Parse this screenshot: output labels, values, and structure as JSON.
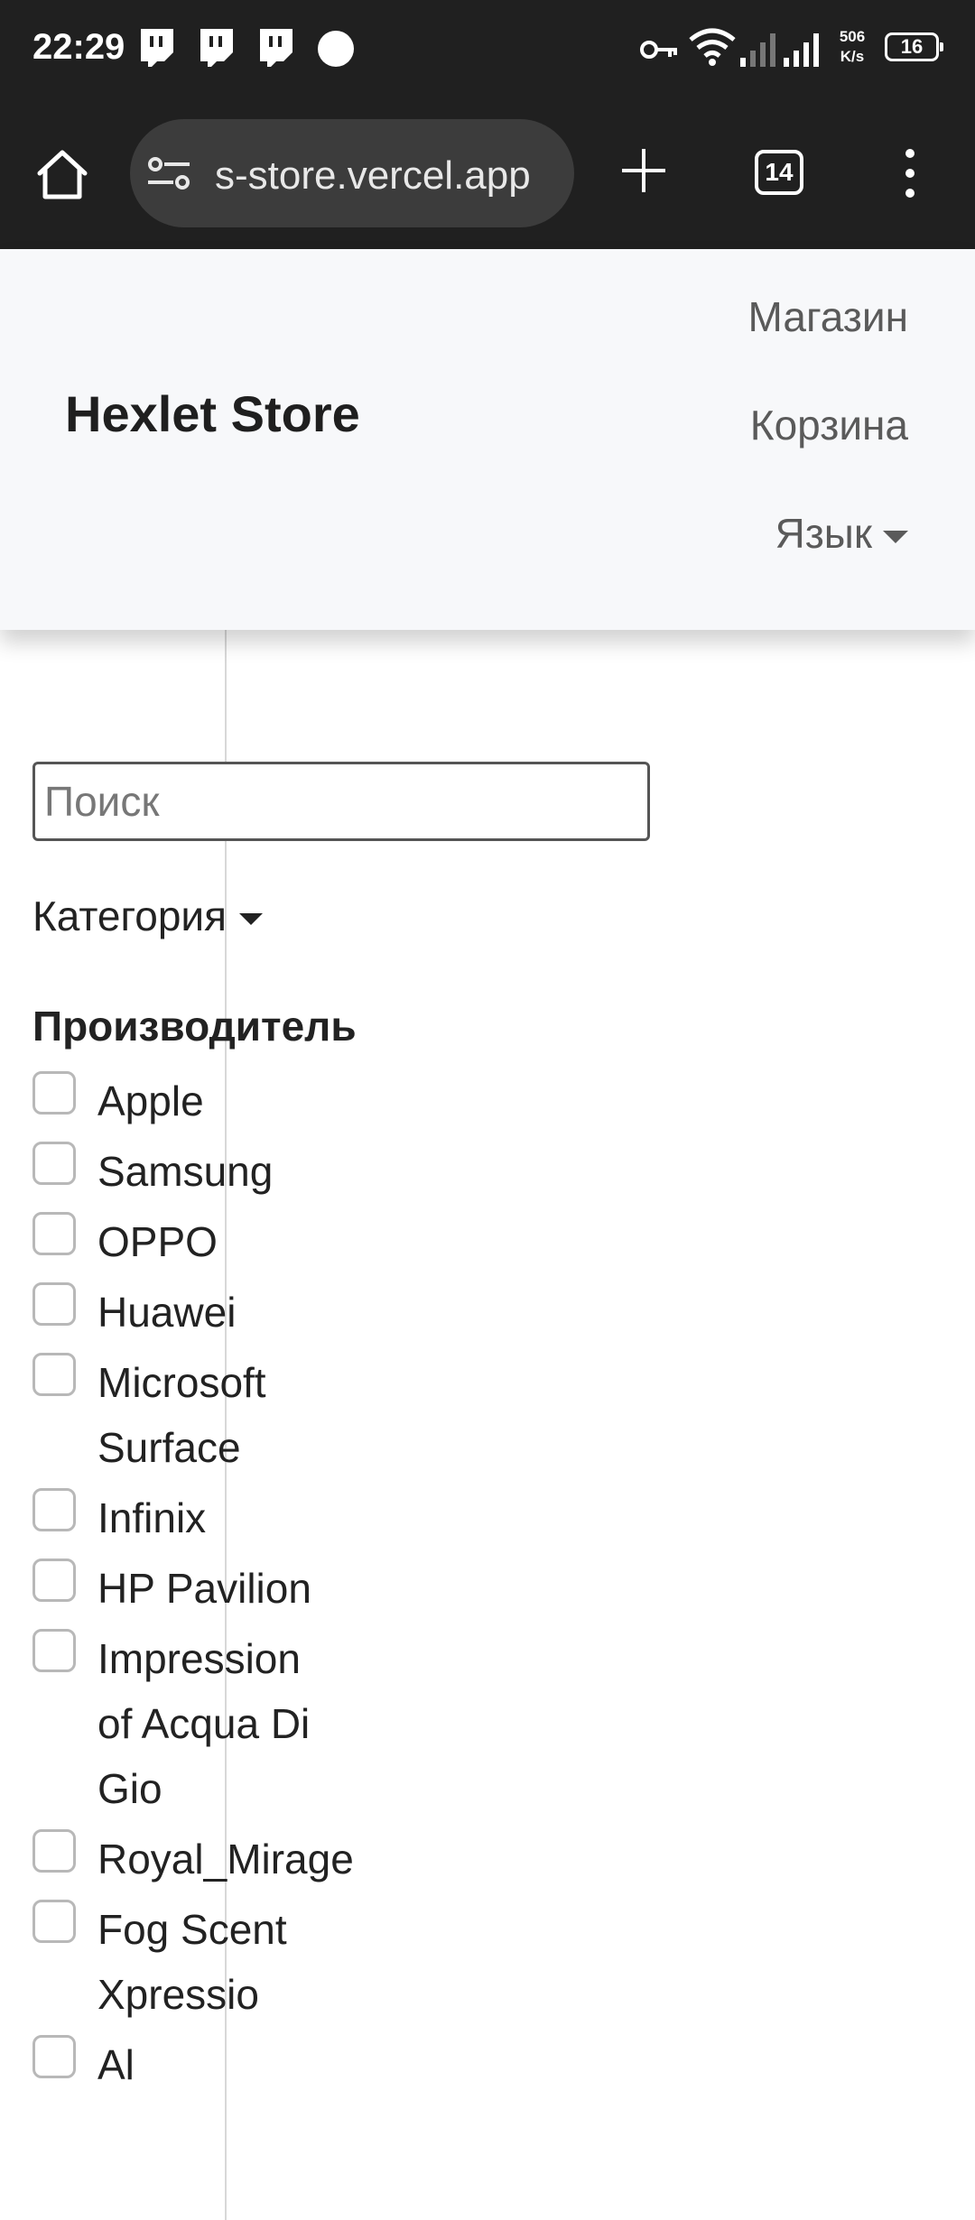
{
  "status_bar": {
    "time": "22:29",
    "net_speed_value": "506",
    "net_speed_unit": "K/s",
    "battery": "16"
  },
  "browser": {
    "url": "s-store.vercel.app",
    "tab_count": "14"
  },
  "navbar": {
    "brand": "Hexlet Store",
    "links": {
      "shop": "Магазин",
      "cart": "Корзина",
      "language": "Язык"
    }
  },
  "filters": {
    "search_placeholder": "Поиск",
    "category_label": "Категория",
    "manufacturer_title": "Производитель",
    "manufacturers": [
      "Apple",
      "Samsung",
      "OPPO",
      "Huawei",
      "Microsoft Surface",
      "Infinix",
      "HP Pavilion",
      "Impression of Acqua Di Gio",
      "Royal_Mirage",
      "Fog Scent Xpressio",
      "Al"
    ]
  }
}
